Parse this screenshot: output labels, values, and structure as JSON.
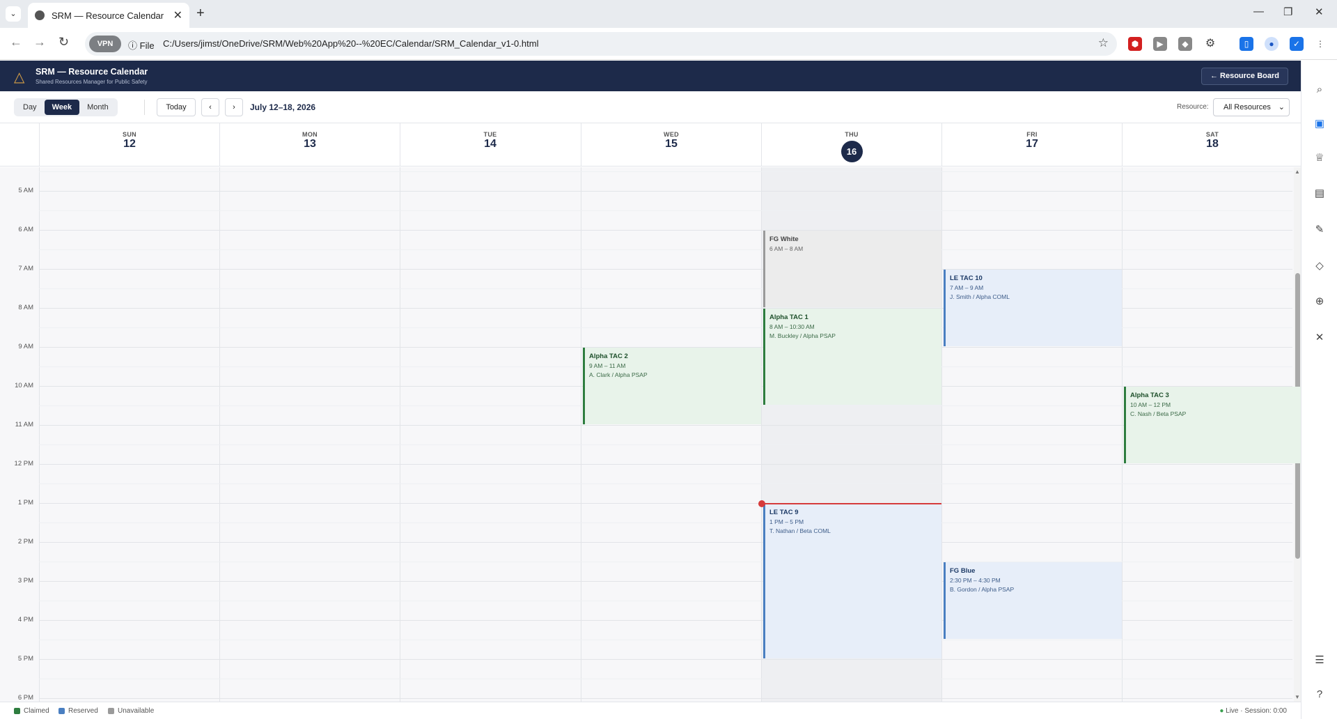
{
  "browser": {
    "tab_title": "SRM — Resource Calendar",
    "tab_close": "✕",
    "new_tab": "+",
    "file_label": "File",
    "url": "C:/Users/jimst/OneDrive/SRM/Web%20App%20--%20EC/Calendar/SRM_Calendar_v1-0.html",
    "vpn_label": "VPN"
  },
  "app": {
    "title": "SRM — Resource Calendar",
    "subtitle": "Shared Resources Manager for Public Safety",
    "resource_board_label": "Resource Board"
  },
  "toolbar": {
    "views": [
      "Day",
      "Week",
      "Month"
    ],
    "active_view": "Week",
    "today_label": "Today",
    "prev_label": "‹",
    "next_label": "›",
    "range_label": "July 12–18, 2026",
    "resource_label": "Resource:",
    "resource_value": "All Resources"
  },
  "days": [
    {
      "name": "SUN",
      "num": "12"
    },
    {
      "name": "MON",
      "num": "13"
    },
    {
      "name": "TUE",
      "num": "14"
    },
    {
      "name": "WED",
      "num": "15"
    },
    {
      "name": "THU",
      "num": "16",
      "today": true
    },
    {
      "name": "FRI",
      "num": "17"
    },
    {
      "name": "SAT",
      "num": "18"
    }
  ],
  "hours": [
    "5 AM",
    "6 AM",
    "7 AM",
    "8 AM",
    "9 AM",
    "10 AM",
    "11 AM",
    "12 PM",
    "1 PM",
    "2 PM",
    "3 PM",
    "4 PM",
    "5 PM",
    "6 PM"
  ],
  "events": [
    {
      "title": "FG White",
      "time": "6 AM – 8 AM",
      "who": "",
      "status": "unavailable",
      "day": 4,
      "start": 6,
      "end": 8
    },
    {
      "title": "Alpha TAC 1",
      "time": "8 AM – 10:30 AM",
      "who": "M. Buckley / Alpha PSAP",
      "status": "claimed",
      "day": 4,
      "start": 8,
      "end": 10.5
    },
    {
      "title": "LE TAC 10",
      "time": "7 AM – 9 AM",
      "who": "J. Smith / Alpha COML",
      "status": "reserved",
      "day": 5,
      "start": 7,
      "end": 9
    },
    {
      "title": "Alpha TAC 2",
      "time": "9 AM – 11 AM",
      "who": "A. Clark / Alpha PSAP",
      "status": "claimed",
      "day": 3,
      "start": 9,
      "end": 11
    },
    {
      "title": "Alpha TAC 3",
      "time": "10 AM – 12 PM",
      "who": "C. Nash / Beta PSAP",
      "status": "claimed",
      "day": 6,
      "start": 10,
      "end": 12
    },
    {
      "title": "LE TAC 9",
      "time": "1 PM – 5 PM",
      "who": "T. Nathan / Beta COML",
      "status": "reserved",
      "day": 4,
      "start": 13,
      "end": 17
    },
    {
      "title": "FG Blue",
      "time": "2:30 PM – 4:30 PM",
      "who": "B. Gordon / Alpha PSAP",
      "status": "reserved",
      "day": 5,
      "start": 14.5,
      "end": 16.5
    }
  ],
  "now": {
    "day": 4,
    "hour": 13
  },
  "legend": [
    {
      "label": "Claimed",
      "color": "#2e7d3f"
    },
    {
      "label": "Reserved",
      "color": "#4a7fc1"
    },
    {
      "label": "Unavailable",
      "color": "#9a9a9a"
    }
  ],
  "status": {
    "live": "Live",
    "session": "Session:",
    "session_time": "0:00"
  },
  "colors": {
    "header_bg": "#1d2a4a",
    "now_line": "#d63b3b"
  }
}
